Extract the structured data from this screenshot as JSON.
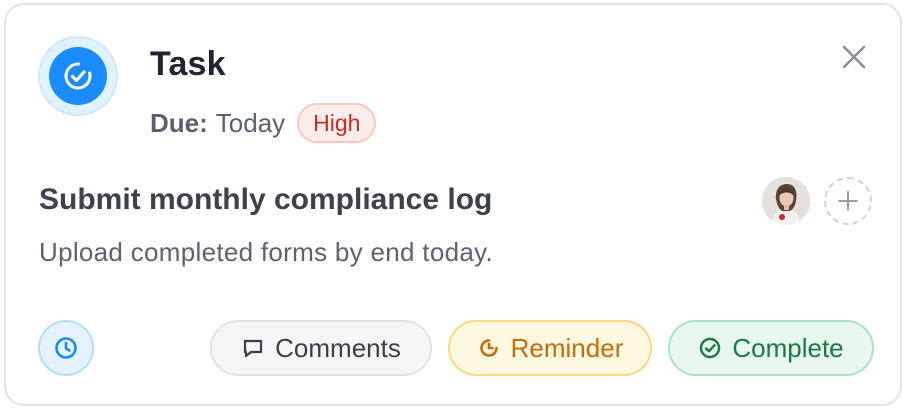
{
  "task": {
    "type_label": "Task",
    "due_label": "Due:",
    "due_value": "Today",
    "priority": "High",
    "title": "Submit monthly compliance log",
    "description": "Upload completed forms by end today."
  },
  "actions": {
    "comments_label": "Comments",
    "reminder_label": "Reminder",
    "complete_label": "Complete"
  },
  "icons": {
    "task": "check-circle-icon",
    "close": "close-icon",
    "add_assignee": "plus-icon",
    "clock": "clock-icon",
    "comments": "comment-icon",
    "reminder": "reminder-icon",
    "complete": "check-circle-icon"
  },
  "colors": {
    "accent": "#1a8cff",
    "priority_high": "#c0311f",
    "reminder": "#c76a07",
    "complete": "#1a7a45"
  }
}
